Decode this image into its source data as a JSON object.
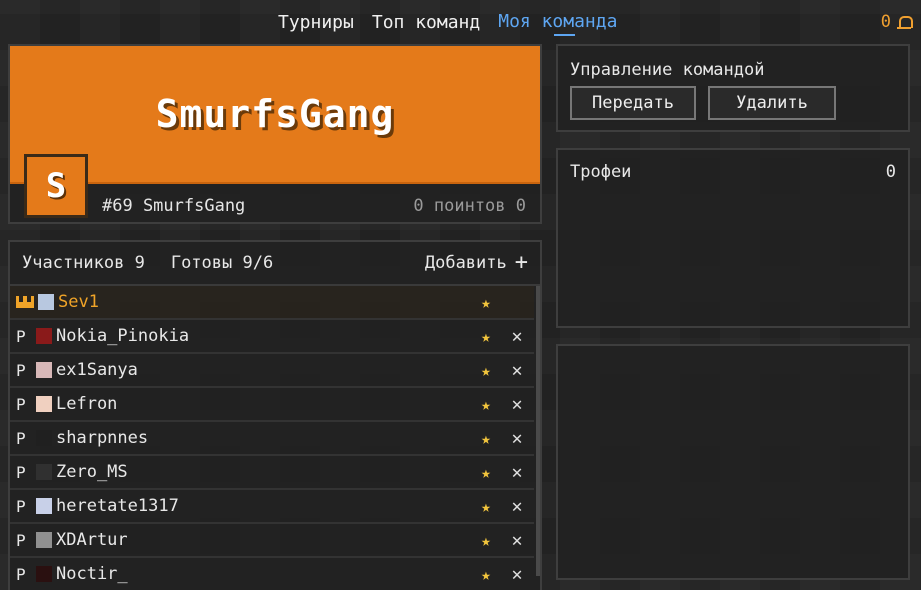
{
  "nav": {
    "tabs": [
      "Турниры",
      "Топ команд",
      "Моя команда"
    ],
    "active_tab": "Моя команда"
  },
  "notifications": {
    "count": "0",
    "icon": "bell-icon"
  },
  "team": {
    "name": "SmurfsGang",
    "logo_letter": "S",
    "rank_line": "#69 SmurfsGang",
    "points_line": "0 поинтов 0",
    "banner_color": "#e47a1a"
  },
  "members_panel": {
    "count_label": "Участников 9",
    "ready_label": "Готовы 9/6",
    "add_label": "Добавить",
    "add_icon": "+",
    "members": [
      {
        "name": "Sev1",
        "role": "crown",
        "avatar": "#b8c8e0"
      },
      {
        "name": "Nokia_Pinokia",
        "role": "P",
        "avatar": "#8a1a1a"
      },
      {
        "name": "ex1Sanya",
        "role": "P",
        "avatar": "#d8b8b8"
      },
      {
        "name": "Lefron",
        "role": "P",
        "avatar": "#f0d0c0"
      },
      {
        "name": "sharpnnes",
        "role": "P",
        "avatar": "#202020"
      },
      {
        "name": "Zero_MS",
        "role": "P",
        "avatar": "#303030"
      },
      {
        "name": "heretate1317",
        "role": "P",
        "avatar": "#c8d0e8"
      },
      {
        "name": "XDArtur",
        "role": "P",
        "avatar": "#909090"
      },
      {
        "name": "Noctir_",
        "role": "P",
        "avatar": "#2a1010"
      }
    ]
  },
  "management": {
    "title": "Управление командой",
    "transfer_label": "Передать",
    "delete_label": "Удалить"
  },
  "trophies": {
    "title": "Трофеи",
    "count": "0"
  },
  "colors": {
    "accent_blue": "#5ea6f2",
    "gold": "#f0a428",
    "star": "#f2c53d"
  }
}
